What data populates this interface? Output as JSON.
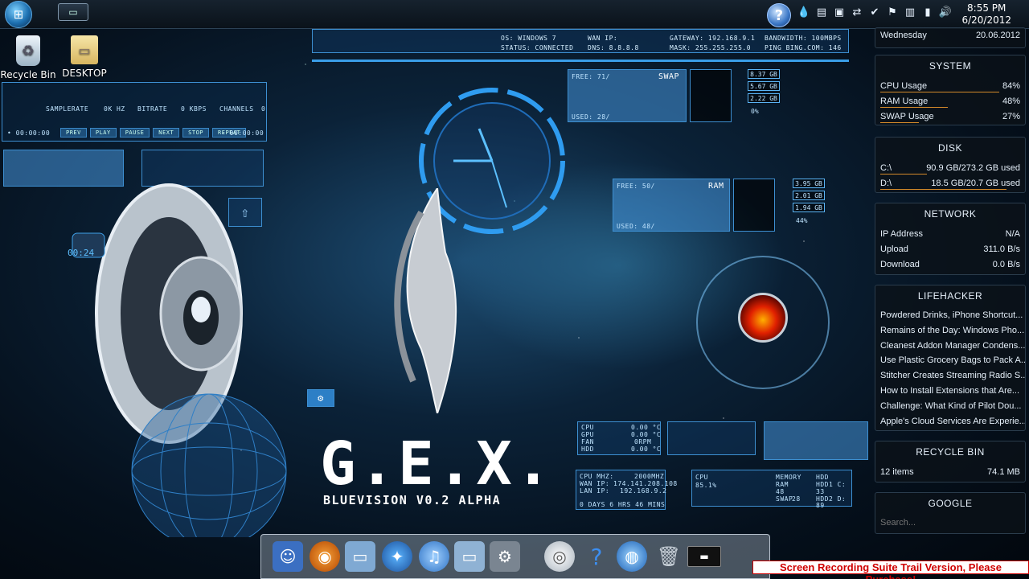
{
  "taskbar": {
    "clock_time": "8:55 PM",
    "clock_date": "6/20/2012",
    "tray_icons": [
      "network-icon",
      "battery-icon",
      "volume-icon",
      "flag-icon",
      "shield-icon",
      "device-icon"
    ]
  },
  "desktop": {
    "icons": [
      {
        "label": "Recycle Bin",
        "icon": "recycle-bin-icon"
      },
      {
        "label": "DESKTOP",
        "icon": "folder-icon"
      }
    ]
  },
  "hud": {
    "top_strip": {
      "os": "OS: WINDOWS 7",
      "status": "STATUS: CONNECTED",
      "wan": "WAN IP:",
      "dns": "DNS: 8.8.8.8",
      "gateway": "GATEWAY: 192.168.9.1",
      "mask": "MASK: 255.255.255.0",
      "bandwidth": "BANDWIDTH: 100MBPS",
      "ping": "PING BING.COM: 146"
    },
    "player": {
      "samplerate": "SAMPLERATE",
      "hz": "0K HZ",
      "bitrate": "BITRATE",
      "kbps": "0 KBPS",
      "channels": "CHANNELS",
      "channels_val": "0",
      "time_left": "• 00:00:00",
      "time_right": "- 00:00:00",
      "buttons": [
        "PREV",
        "PLAY",
        "PAUSE",
        "NEXT",
        "STOP",
        "REPEAT"
      ]
    },
    "swap": {
      "title": "SWAP",
      "free": "FREE: 71/",
      "used": "USED: 28/",
      "v1": "8.37 GB",
      "v2": "5.67 GB",
      "v3": "2.22 GB",
      "v4": "0%"
    },
    "ram": {
      "title": "RAM",
      "free": "FREE: 50/",
      "used": "USED: 48/",
      "v1": "3.95 GB",
      "v2": "2.01 GB",
      "v3": "1.94 GB",
      "v4": "44%"
    },
    "cpu_temp": {
      "cpu": "CPU",
      "cpu_val": "0.00 °C",
      "gpu": "GPU",
      "gpu_val": "0.00 °C",
      "fan": "FAN",
      "fan_val": "0RPM",
      "hdd": "HDD",
      "hdd_val": "0.00 °C"
    },
    "sys_info": {
      "cpu_mhz": "CPU MHZ:",
      "cpu_mhz_val": "2000MHZ",
      "wan_ip": "WAN IP:",
      "wan_ip_val": "174.141.208.108",
      "lan_ip": "LAN IP:",
      "lan_ip_val": "192.168.9.2",
      "uptime": "0 DAYS 6 HRS 46 MINS"
    },
    "cpu_small": {
      "label": "CPU",
      "value": "85.1%"
    },
    "memory_small": {
      "memory": "MEMORY",
      "ram": "RAM",
      "ram_val": "48",
      "swap": "SWAP",
      "swap_val": "28"
    },
    "hdd_small": {
      "hdd": "HDD",
      "c": "HDD1 C:",
      "c_val": "33",
      "d": "HDD2 D:",
      "d_val": "89"
    },
    "clock_widget_time": "00:24"
  },
  "logo": {
    "title": "G.E.X.",
    "subtitle": "BLUEVISION V0.2 ALPHA"
  },
  "sidebar": {
    "date": {
      "day": "Wednesday",
      "date": "20.06.2012"
    },
    "system": {
      "title": "SYSTEM",
      "rows": [
        {
          "label": "CPU Usage",
          "value": "84%",
          "pct": 84
        },
        {
          "label": "RAM Usage",
          "value": "48%",
          "pct": 48
        },
        {
          "label": "SWAP Usage",
          "value": "27%",
          "pct": 27
        }
      ]
    },
    "disk": {
      "title": "DISK",
      "rows": [
        {
          "label": "C:\\",
          "value": "90.9 GB/273.2 GB used",
          "pct": 33
        },
        {
          "label": "D:\\",
          "value": "18.5 GB/20.7 GB used",
          "pct": 89
        }
      ]
    },
    "network": {
      "title": "NETWORK",
      "rows": [
        {
          "label": "IP Address",
          "value": "N/A"
        },
        {
          "label": "Upload",
          "value": "311.0 B/s"
        },
        {
          "label": "Download",
          "value": "0.0 B/s"
        }
      ]
    },
    "lifehacker": {
      "title": "LIFEHACKER",
      "items": [
        "Powdered Drinks, iPhone Shortcut...",
        "Remains of the Day: Windows Pho...",
        "Cleanest Addon Manager Condens...",
        "Use Plastic Grocery Bags to Pack A...",
        "Stitcher Creates Streaming Radio S...",
        "How to Install Extensions that Are...",
        "Challenge: What Kind of Pilot Dou...",
        "Apple's Cloud Services Are Experie..."
      ]
    },
    "recycle": {
      "title": "RECYCLE BIN",
      "items": "12 items",
      "size": "74.1 MB"
    },
    "google": {
      "title": "GOOGLE",
      "placeholder": "Search..."
    }
  },
  "dock": {
    "items": [
      "finder-icon",
      "firefox-icon",
      "folder-icon",
      "browser-icon",
      "itunes-icon",
      "folder-icon",
      "settings-icon",
      "disc-icon",
      "help-icon",
      "globe-icon",
      "trash-icon",
      "terminal-icon"
    ]
  },
  "watermark": "Screen Recording Suite Trail Version, Please Purchase!",
  "colors": {
    "accent": "#3a9ee8",
    "bar": "#d48a2a",
    "watermark": "#d00000"
  }
}
